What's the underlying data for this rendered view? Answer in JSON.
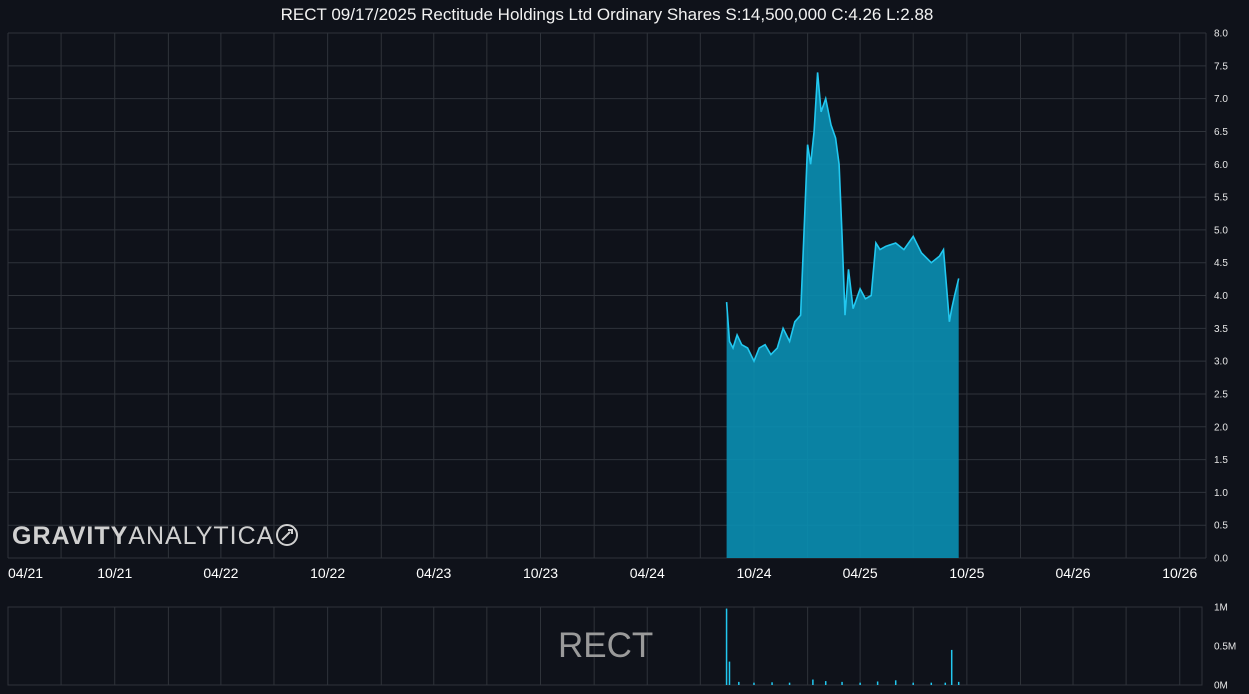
{
  "header": {
    "title": "RECT 09/17/2025 Rectitude Holdings Ltd Ordinary Shares S:14,500,000 C:4.26 L:2.88"
  },
  "branding": {
    "logo_bold": "GRAVITY",
    "logo_light": "ANALYTICA",
    "ticker_watermark": "RECT"
  },
  "colors": {
    "background": "#0f121a",
    "grid": "#2f333a",
    "line": "#22c8f0",
    "fill": "#0a8fb2"
  },
  "chart_data": [
    {
      "type": "area",
      "title": "RECT 09/17/2025 Rectitude Holdings Ltd Ordinary Shares S:14,500,000 C:4.26 L:2.88",
      "x_tick_labels": [
        "04/21",
        "10/21",
        "04/22",
        "10/22",
        "04/23",
        "10/23",
        "04/24",
        "10/24",
        "04/25",
        "10/25",
        "04/26",
        "10/26"
      ],
      "y_tick_labels": [
        "0.0",
        "0.5",
        "1.0",
        "1.5",
        "2.0",
        "2.5",
        "3.0",
        "3.5",
        "4.0",
        "4.5",
        "5.0",
        "5.5",
        "6.0",
        "6.5",
        "7.0",
        "7.5",
        "8.0"
      ],
      "ylim": [
        0,
        8
      ],
      "xlim": [
        "2021-04-01",
        "2026-11-15"
      ],
      "grid": true,
      "series": [
        {
          "x": [
            "2024-08-15",
            "2024-08-20",
            "2024-08-26",
            "2024-09-02",
            "2024-09-10",
            "2024-09-20",
            "2024-10-01",
            "2024-10-10",
            "2024-10-20",
            "2024-10-30",
            "2024-11-10",
            "2024-11-20",
            "2024-12-01",
            "2024-12-10",
            "2024-12-20",
            "2025-01-01",
            "2025-01-06",
            "2025-01-12",
            "2025-01-18",
            "2025-01-24",
            "2025-02-01",
            "2025-02-10",
            "2025-02-18",
            "2025-02-24",
            "2025-03-01",
            "2025-03-06",
            "2025-03-12",
            "2025-03-20",
            "2025-04-01",
            "2025-04-10",
            "2025-04-20",
            "2025-04-28",
            "2025-05-05",
            "2025-05-15",
            "2025-06-01",
            "2025-06-15",
            "2025-07-01",
            "2025-07-15",
            "2025-08-01",
            "2025-08-15",
            "2025-08-22",
            "2025-09-01",
            "2025-09-05",
            "2025-09-10",
            "2025-09-17"
          ],
          "values": [
            3.9,
            3.3,
            3.2,
            3.4,
            3.25,
            3.2,
            3.0,
            3.2,
            3.25,
            3.1,
            3.2,
            3.5,
            3.3,
            3.6,
            3.7,
            6.3,
            6.0,
            6.5,
            7.4,
            6.8,
            7.0,
            6.6,
            6.4,
            6.0,
            4.9,
            3.7,
            4.4,
            3.8,
            4.1,
            3.95,
            4.0,
            4.8,
            4.7,
            4.75,
            4.8,
            4.7,
            4.9,
            4.65,
            4.5,
            4.6,
            4.7,
            3.6,
            3.8,
            4.0,
            4.26
          ]
        }
      ]
    },
    {
      "type": "bar",
      "y_tick_labels": [
        "0M",
        "0.5M",
        "1M"
      ],
      "ylim": [
        0,
        1000000
      ],
      "series": [
        {
          "x": [
            "2024-08-15",
            "2024-08-20",
            "2024-09-05",
            "2024-10-01",
            "2024-11-01",
            "2024-12-01",
            "2025-01-10",
            "2025-02-01",
            "2025-03-01",
            "2025-04-01",
            "2025-05-01",
            "2025-06-01",
            "2025-07-01",
            "2025-08-01",
            "2025-08-25",
            "2025-09-05",
            "2025-09-17"
          ],
          "values": [
            980000,
            300000,
            40000,
            30000,
            35000,
            30000,
            70000,
            50000,
            40000,
            30000,
            45000,
            60000,
            30000,
            30000,
            30000,
            450000,
            40000
          ]
        }
      ]
    }
  ]
}
